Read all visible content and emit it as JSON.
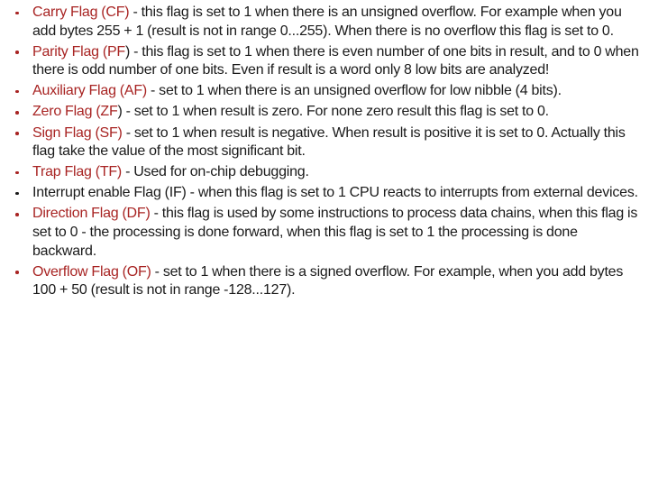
{
  "slide": {
    "background_color": "#ffffff",
    "accent_color": "#a82423",
    "text_color": "#1a1a1a",
    "bullets": [
      {
        "id": "carry-flag",
        "name": "Carry Flag (CF)",
        "name_colored": true,
        "bullet_color": "#a82423",
        "body": " - this flag is set to 1 when there is an unsigned overflow. For example when you add bytes 255 + 1 (result is not in range 0...255). When there is no overflow this flag is set to 0."
      },
      {
        "id": "parity-flag",
        "name": "Parity Flag (PF",
        "name_tail": ")",
        "name_colored": true,
        "bullet_color": "#a82423",
        "body": " - this flag is set to 1 when there is even number of one bits in result, and to 0 when there is odd number of one bits. Even if result is a word only 8 low bits are analyzed!"
      },
      {
        "id": "auxiliary-flag",
        "name": "Auxiliary Flag (AF)",
        "name_colored": true,
        "bullet_color": "#a82423",
        "body": " - set to 1 when there is an unsigned overflow for low nibble (4 bits)."
      },
      {
        "id": "zero-flag",
        "name": "Zero Flag (ZF",
        "name_tail": ")",
        "name_colored": true,
        "bullet_color": "#a82423",
        "body": " - set to 1 when result is zero. For none zero result this flag is set to 0."
      },
      {
        "id": "sign-flag",
        "name": "Sign Flag (SF)",
        "name_colored": true,
        "bullet_color": "#a82423",
        "body": " - set to 1 when result is negative. When result is positive it is set to 0. Actually this flag take the value of the most significant bit."
      },
      {
        "id": "trap-flag",
        "name": "Trap Flag (TF)",
        "name_colored": true,
        "bullet_color": "#a82423",
        "body": " - Used for on-chip debugging."
      },
      {
        "id": "interrupt-enable-flag",
        "name": "Interrupt enable Flag (IF)",
        "name_colored": false,
        "bullet_color": "#1a1a1a",
        "body": " - when this flag is set to 1 CPU reacts to interrupts from external devices."
      },
      {
        "id": "direction-flag",
        "name": "Direction Flag (DF)",
        "name_colored": true,
        "bullet_color": "#a82423",
        "body": " - this flag is used by some instructions to process data chains, when this flag is set to 0 - the processing is done forward, when this flag is set to 1 the processing is done backward."
      },
      {
        "id": "overflow-flag",
        "name": "Overflow Flag (OF)",
        "name_colored": true,
        "bullet_color": "#a82423",
        "body": " - set to 1 when there is a signed overflow. For example, when you add bytes 100 + 50 (result is not in range -128...127)."
      }
    ]
  }
}
